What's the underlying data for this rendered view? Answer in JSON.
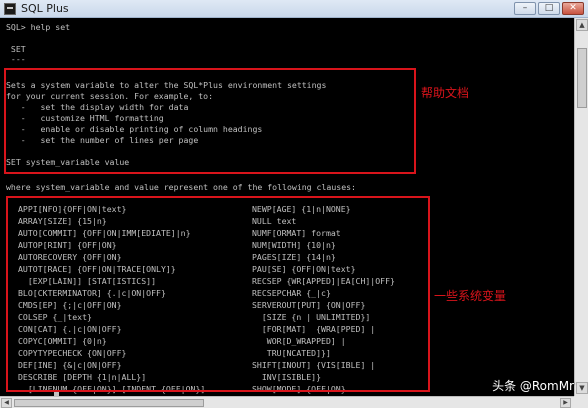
{
  "window": {
    "title": "SQL Plus",
    "minimize_glyph": "–",
    "maximize_glyph": "□",
    "close_glyph": "✕"
  },
  "console": {
    "header_lines": [
      "SQL> help set",
      "",
      " SET",
      " ---"
    ],
    "description_lines": [
      "Sets a system variable to alter the SQL*Plus environment settings",
      "for your current session. For example, to:",
      "   -   set the display width for data",
      "   -   customize HTML formatting",
      "   -   enable or disable printing of column headings",
      "   -   set the number of lines per page",
      "",
      "SET system_variable value"
    ],
    "where_line": "where system_variable and value represent one of the following clauses:",
    "clauses_left": [
      "APPI[NFO]{OFF|ON|text}",
      "ARRAY[SIZE] {15|n}",
      "AUTO[COMMIT] {OFF|ON|IMM[EDIATE]|n}",
      "AUTOP[RINT] {OFF|ON}",
      "AUTORECOVERY {OFF|ON}",
      "AUTOT[RACE] {OFF|ON|TRACE[ONLY]}",
      "  [EXP[LAIN]] [STAT[ISTICS]]",
      "BLO[CKTERMINATOR] {.|c|ON|OFF}",
      "CMDS[EP] {;|c|OFF|ON}",
      "COLSEP {_|text}",
      "CON[CAT] {.|c|ON|OFF}",
      "COPYC[OMMIT] {0|n}",
      "COPYTYPECHECK {ON|OFF}",
      "DEF[INE] {&|c|ON|OFF}",
      "DESCRIBE [DEPTH {1|n|ALL}]",
      "  [LINENUM {OFF|ON}] [INDENT {OFF|ON}]"
    ],
    "clauses_right": [
      "NEWP[AGE] {1|n|NONE}",
      "NULL text",
      "NUMF[ORMAT] format",
      "NUM[WIDTH] {10|n}",
      "PAGES[IZE] {14|n}",
      "PAU[SE] {OFF|ON|text}",
      "RECSEP {WR[APPED]|EA[CH]|OFF}",
      "RECSEPCHAR {_|c}",
      "SERVEROUT[PUT] {ON|OFF}",
      "  [SIZE {n | UNLIMITED}]",
      "  [FOR[MAT]  {WRA[PPED] |",
      "   WOR[D_WRAPPED] |",
      "   TRU[NCATED]}]",
      "SHIFT[INOUT] {VIS[IBLE] |",
      "  INV[ISIBLE]}",
      "SHOW[MODE] {OFF|ON}"
    ]
  },
  "annotations": {
    "help_doc": "帮助文档",
    "system_vars": "一些系统变量"
  },
  "watermark": "头条 @RomMr",
  "colors": {
    "console_bg": "#000000",
    "console_text": "#c0c0c0",
    "annotation_red": "#d9141b"
  },
  "icons": {
    "window_icon": "console-icon",
    "scroll_up": "arrow-up-icon",
    "scroll_down": "arrow-down-icon",
    "scroll_left": "arrow-left-icon",
    "scroll_right": "arrow-right-icon"
  }
}
